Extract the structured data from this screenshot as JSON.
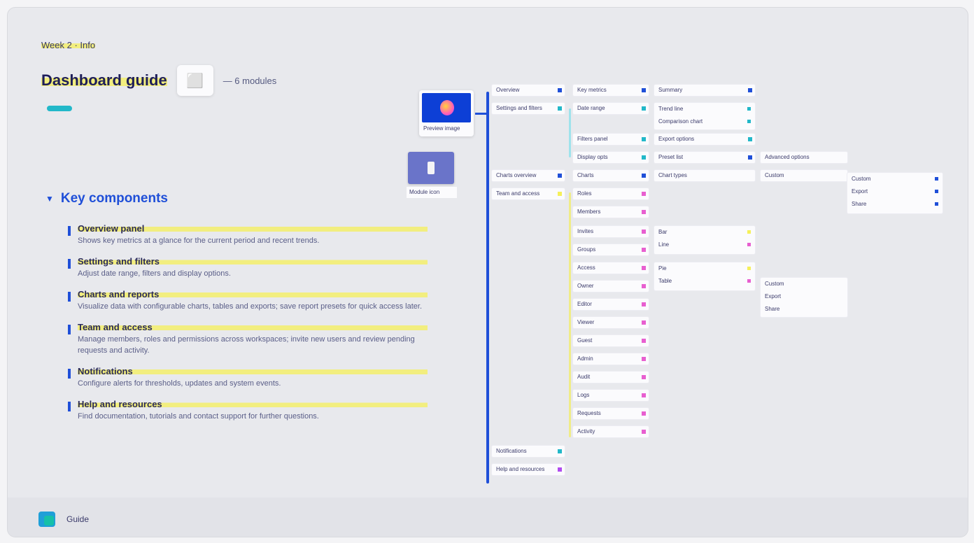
{
  "header": {
    "topline": "Week 2 · Info",
    "title": "Dashboard guide",
    "subtitle": "— 6 modules"
  },
  "section": {
    "title": "Key components"
  },
  "items": [
    {
      "head": "Overview panel",
      "desc": "Shows key metrics at a glance for the current period and recent trends."
    },
    {
      "head": "Settings and filters",
      "desc": "Adjust date range, filters and display options."
    },
    {
      "head": "Charts and reports",
      "desc": "Visualize data with configurable charts, tables and exports; save report presets for quick access later."
    },
    {
      "head": "Team and access",
      "desc": "Manage members, roles and permissions across workspaces; invite new users and review pending requests and activity."
    },
    {
      "head": "Notifications",
      "desc": "Configure alerts for thresholds, updates and system events."
    },
    {
      "head": "Help and resources",
      "desc": "Find documentation, tutorials and contact support for further questions."
    }
  ],
  "preview": {
    "caption": "Preview image"
  },
  "thumb": {
    "caption": "Module icon"
  },
  "tree": {
    "root1": "Overview",
    "root2": "Settings and filters",
    "root3": "Charts overview",
    "root4": "Team and access",
    "root5": "Notifications",
    "root6": "Help and resources",
    "l2": [
      "Key metrics",
      "Date range",
      "Filters panel",
      "Display opts",
      "Charts",
      "Roles",
      "Members",
      "Invites",
      "Groups",
      "Access",
      "Owner",
      "Editor",
      "Viewer",
      "Guest",
      "Admin",
      "Audit",
      "Logs",
      "Requests",
      "Activity"
    ],
    "l3": [
      "Summary",
      "Trend line",
      "Comparison chart",
      "Export options",
      "Preset list",
      "Chart types",
      "Bar",
      "Line",
      "Pie",
      "Table"
    ],
    "l4": [
      "Advanced options",
      "Custom",
      "Export",
      "Share"
    ]
  },
  "footer": {
    "text": "Guide"
  },
  "colors": {
    "accent": "#1f4fd8",
    "teal": "#22b8c9",
    "pink": "#e85fd0",
    "highlight": "#f5f05a"
  },
  "icons": {
    "preview": "image-icon",
    "thumb": "slide-icon",
    "logo": "app-logo-icon"
  }
}
